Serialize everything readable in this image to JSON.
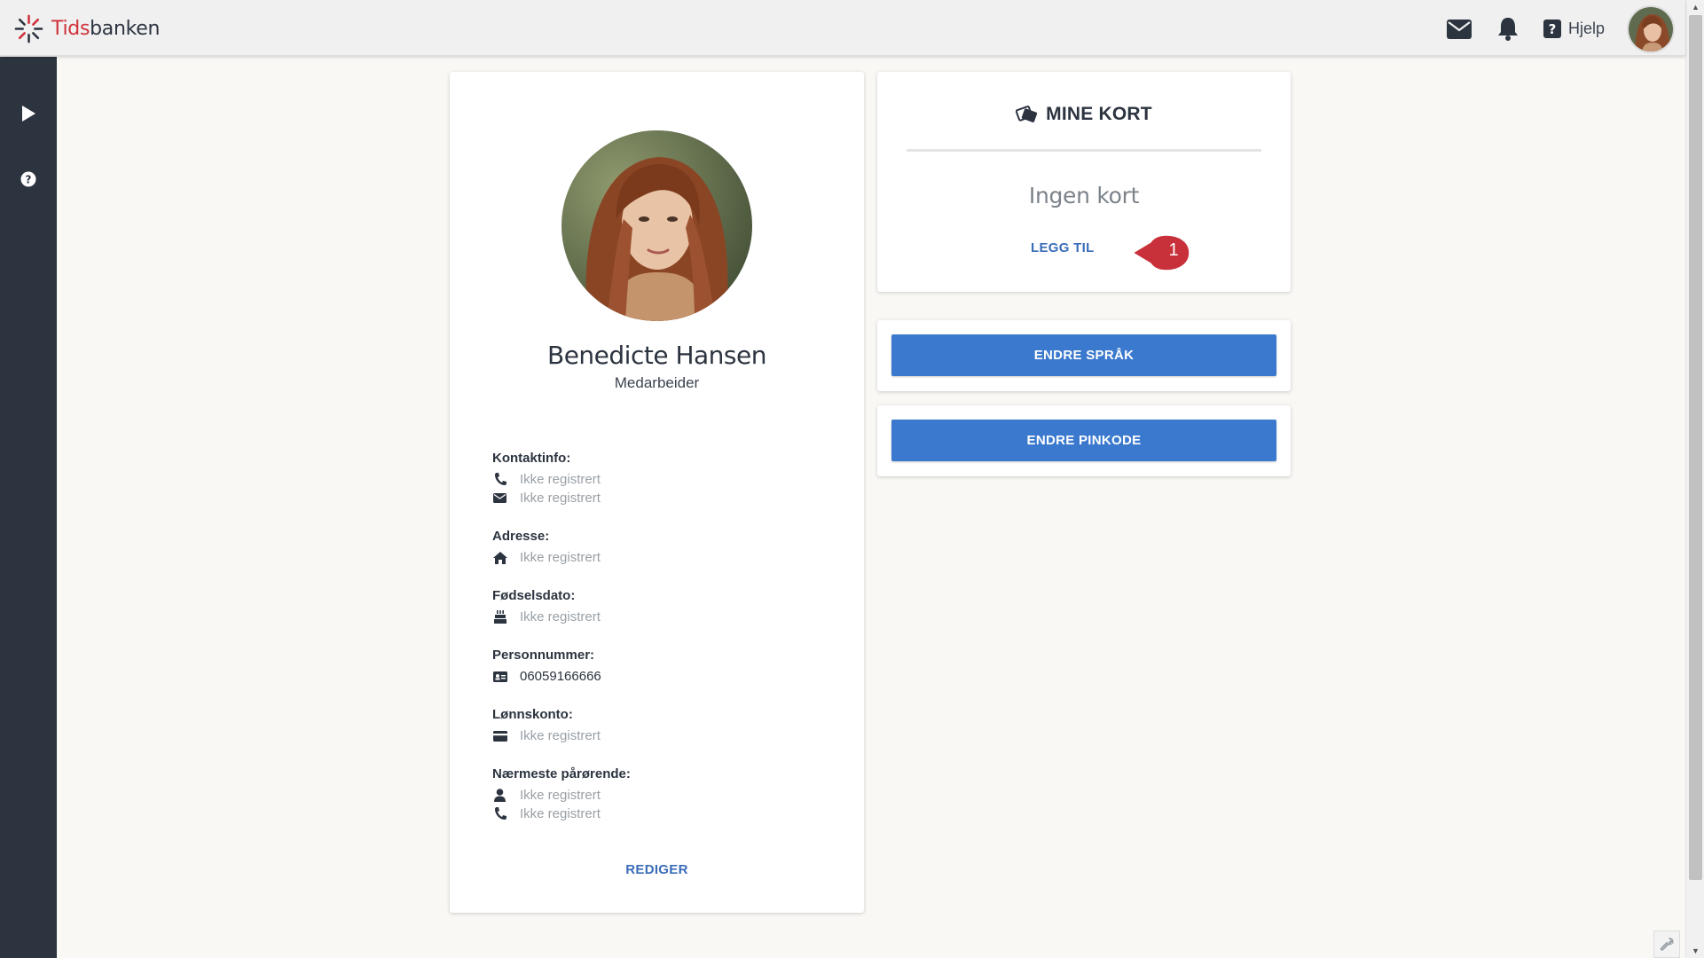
{
  "app": {
    "logo_part1": "Tids",
    "logo_part2": "banken"
  },
  "header": {
    "help_label": "Hjelp",
    "icons": [
      "envelope-icon",
      "bell-icon",
      "question-square-icon"
    ]
  },
  "sidebar": {
    "items": [
      "play-icon",
      "question-circle-icon"
    ]
  },
  "profile": {
    "name": "Benedicte Hansen",
    "role": "Medarbeider",
    "contact_label": "Kontaktinfo:",
    "phone": "Ikke registrert",
    "email": "Ikke registrert",
    "address_label": "Adresse:",
    "address": "Ikke registrert",
    "birth_label": "Fødselsdato:",
    "birth": "Ikke registrert",
    "ssn_label": "Personnummer:",
    "ssn": "06059166666",
    "account_label": "Lønnskonto:",
    "account": "Ikke registrert",
    "relative_label": "Nærmeste pårørende:",
    "relative_name": "Ikke registrert",
    "relative_phone": "Ikke registrert",
    "edit_label": "REDIGER"
  },
  "cards": {
    "title": "MINE KORT",
    "empty_text": "Ingen kort",
    "add_label": "LEGG TIL",
    "callout_number": "1"
  },
  "actions": {
    "change_language": "ENDRE SPRÅK",
    "change_pin": "ENDRE PINKODE"
  },
  "colors": {
    "brand_red": "#d0313a",
    "sidebar": "#2c3440",
    "button_blue": "#3b79ce",
    "link_blue": "#3a6cb8",
    "callout_red": "#c8313a"
  }
}
